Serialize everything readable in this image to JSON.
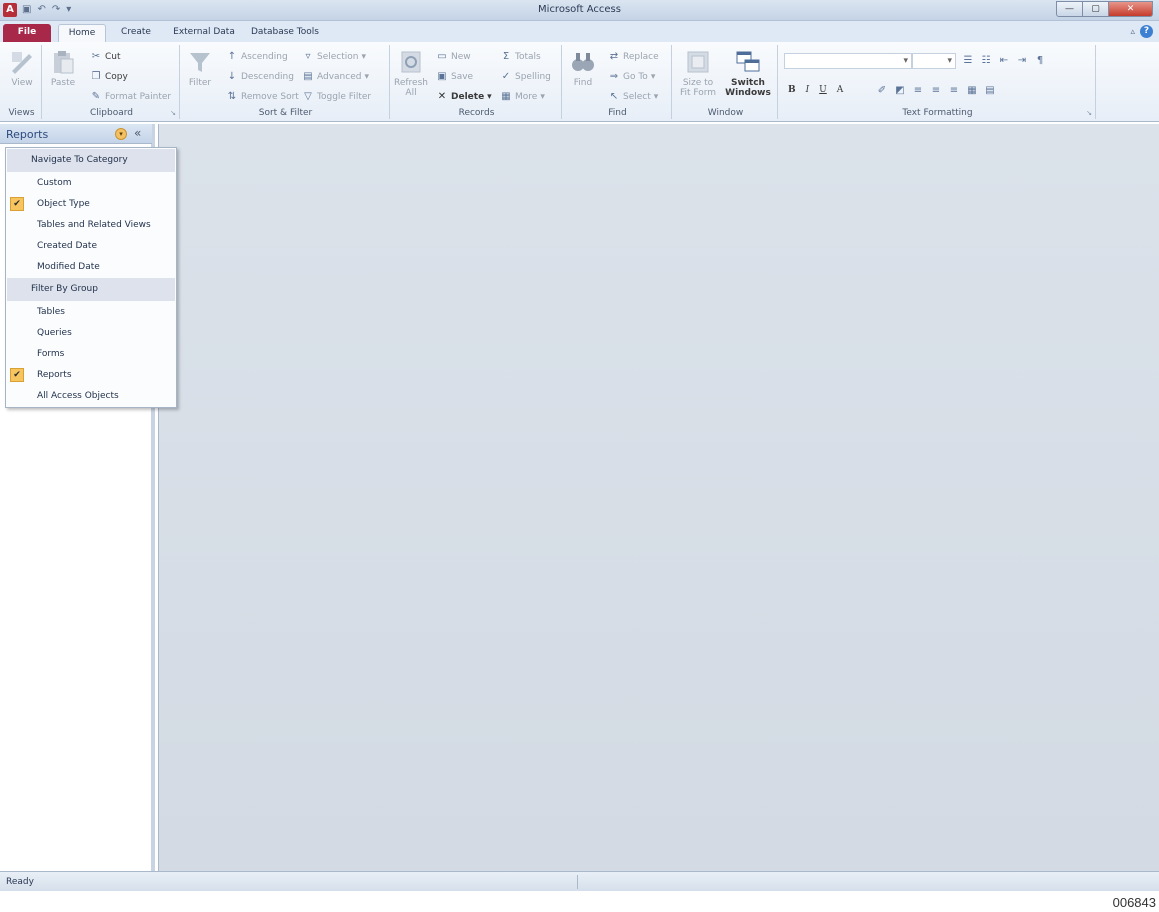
{
  "window": {
    "title": "Microsoft Access",
    "app_icon": "A",
    "controls": {
      "minimize": "—",
      "maximize": "▢",
      "close": "✕"
    }
  },
  "qat": {
    "save_icon": "▣",
    "undo_icon": "↶",
    "redo_icon": "↷",
    "customize_icon": "▾"
  },
  "tabs": {
    "file": "File",
    "home": "Home",
    "create": "Create",
    "external_data": "External Data",
    "database_tools": "Database Tools"
  },
  "ribbon": {
    "views": {
      "label": "Views",
      "view": "View"
    },
    "clipboard": {
      "label": "Clipboard",
      "paste": "Paste",
      "cut": "Cut",
      "copy": "Copy",
      "format_painter": "Format Painter"
    },
    "sort_filter": {
      "label": "Sort & Filter",
      "filter": "Filter",
      "ascending": "Ascending",
      "descending": "Descending",
      "remove_sort": "Remove Sort",
      "selection": "Selection",
      "advanced": "Advanced",
      "toggle_filter": "Toggle Filter"
    },
    "records": {
      "label": "Records",
      "refresh": "Refresh",
      "refresh_all": "All",
      "new": "New",
      "save": "Save",
      "delete": "Delete",
      "totals": "Totals",
      "spelling": "Spelling",
      "more": "More"
    },
    "find": {
      "label": "Find",
      "find": "Find",
      "replace": "Replace",
      "goto": "Go To",
      "select": "Select"
    },
    "window": {
      "label": "Window",
      "size_to": "Size to",
      "fit_form": "Fit Form",
      "switch": "Switch",
      "windows": "Windows"
    },
    "text_formatting": {
      "label": "Text Formatting",
      "bold": "B",
      "italic": "I",
      "underline": "U",
      "font_color": "A"
    }
  },
  "nav": {
    "title": "Reports",
    "dropdown_icon": "▾",
    "collapse_icon": "«"
  },
  "menu": {
    "header_navigate": "Navigate To Category",
    "custom": "Custom",
    "object_type": "Object Type",
    "tables_related": "Tables and Related Views",
    "created_date": "Created Date",
    "modified_date": "Modified Date",
    "header_filter": "Filter By Group",
    "tables": "Tables",
    "queries": "Queries",
    "forms": "Forms",
    "reports": "Reports",
    "all_objects": "All Access Objects",
    "check": "✔"
  },
  "status": {
    "text": "Ready"
  },
  "page_id": "006843",
  "colors": {
    "file_tab": "#a8284a",
    "check": "#f7c560",
    "workspace": "#d8dfe7"
  }
}
